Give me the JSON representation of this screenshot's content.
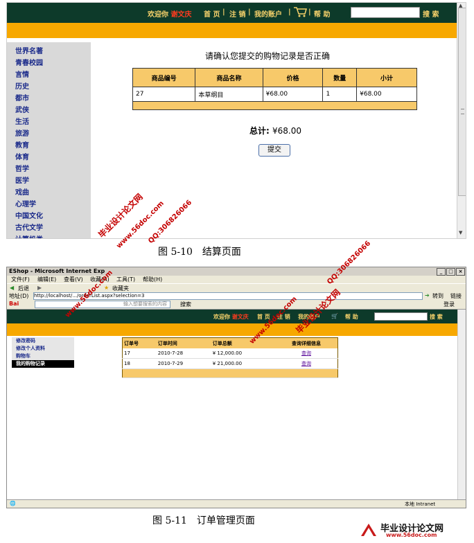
{
  "figure1": {
    "topbar": {
      "greeting": "欢迎你",
      "username": "谢文庆",
      "nav": [
        "首 页",
        "注 销",
        "我的账户",
        "帮 助"
      ],
      "search_button": "搜 索"
    },
    "sidebar": {
      "categories": [
        "世界名著",
        "青春校园",
        "言情",
        "历史",
        "都市",
        "武侠",
        "生活",
        "旅游",
        "教育",
        "体育",
        "哲学",
        "医学",
        "戏曲",
        "心理学",
        "中国文化",
        "古代文学",
        "计算机类"
      ]
    },
    "title": "请确认您提交的购物记录是否正确",
    "table": {
      "headers": [
        "商品编号",
        "商品名称",
        "价格",
        "数量",
        "小计"
      ],
      "rows": [
        [
          "27",
          "本草纲目",
          "¥68.00",
          "1",
          "¥68.00"
        ]
      ]
    },
    "total_label": "总计:",
    "total_value": "¥68.00",
    "submit_label": "提交"
  },
  "caption1": "图 5-10　结算页面",
  "figure2": {
    "window_title": "EShop - Microsoft Internet Exp",
    "menu": [
      "文件(F)",
      "编辑(E)",
      "查看(V)",
      "收藏(A)",
      "工具(T)",
      "帮助(H)"
    ],
    "toolbar": [
      "后退",
      "收藏夹"
    ],
    "address_label": "地址(D)",
    "address_value": "http://localhost/.../orderList.aspx?selection=3",
    "go_label": "转到",
    "links_label": "链接",
    "baidu_placeholder": "输入想要搜索的内容",
    "baidu_search": "搜索",
    "login_label": "登录",
    "topbar": {
      "greeting": "欢迎你",
      "username": "谢文庆",
      "nav": [
        "首 页",
        "注 销",
        "我的账户",
        "帮 助"
      ],
      "search_button": "搜 索"
    },
    "account_menu": [
      "修改密码",
      "修改个人资料",
      "购物车",
      "我的购物记录"
    ],
    "orders": {
      "headers": [
        "订单号",
        "订单时间",
        "订单总额",
        "查询详细信息"
      ],
      "rows": [
        [
          "17",
          "2010-7-28",
          "¥ 12,000.00",
          "查询"
        ],
        [
          "18",
          "2010-7-29",
          "¥ 21,000.00",
          "查询"
        ]
      ]
    },
    "status_zone": "本地 Intranet"
  },
  "caption2": "图 5-11　订单管理页面",
  "watermarks": {
    "site_name": "毕业设计论文网",
    "site_url": "www.56doc.com",
    "qq": "QQ:306826066"
  },
  "colors": {
    "header_dark": "#0d3a2a",
    "orange": "#f7a800",
    "table_header": "#f7c96a",
    "watermark": "#c40000"
  }
}
